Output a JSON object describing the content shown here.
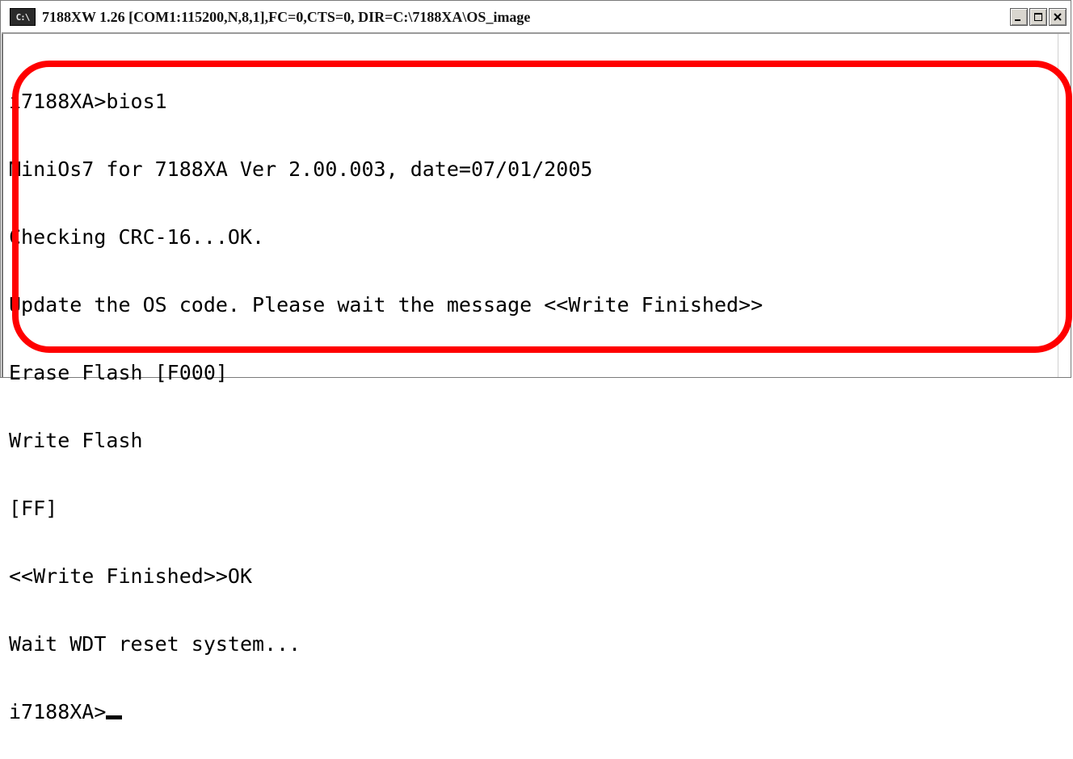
{
  "window": {
    "icon_text": "C:\\",
    "title": "7188XW 1.26 [COM1:115200,N,8,1],FC=0,CTS=0, DIR=C:\\7188XA\\OS_image"
  },
  "console": {
    "lines": [
      "i7188XA>bios1",
      "MiniOs7 for 7188XA Ver 2.00.003, date=07/01/2005",
      "Checking CRC-16...OK.",
      "Update the OS code. Please wait the message <<Write Finished>>",
      "Erase Flash [F000]",
      "Write Flash",
      "[FF]",
      "<<Write Finished>>OK",
      "Wait WDT reset system...",
      "i7188XA>"
    ]
  },
  "colors": {
    "highlight": "#ff0000",
    "console_bg": "#ffffff",
    "text": "#000000"
  }
}
